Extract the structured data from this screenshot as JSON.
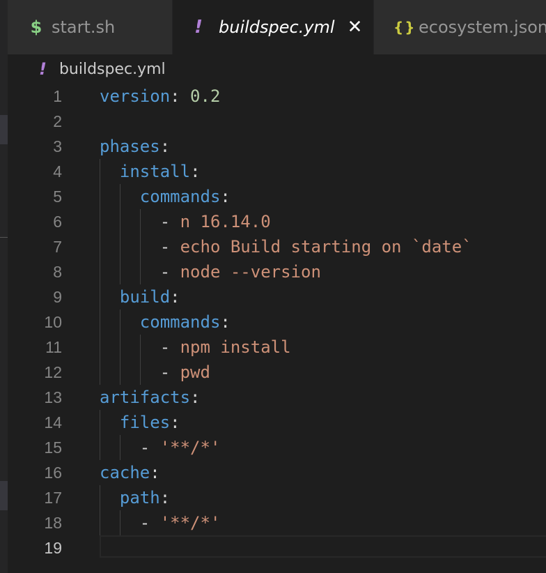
{
  "tabs": [
    {
      "icon": "$",
      "label": "start.sh"
    },
    {
      "icon": "!",
      "label": "buildspec.yml",
      "active": true
    },
    {
      "icon": "{}",
      "label": "ecosystem.json"
    }
  ],
  "close_glyph": "✕",
  "breadcrumb": {
    "icon": "!",
    "file": "buildspec.yml"
  },
  "colors": {
    "key": "#569cd6",
    "string": "#ce9178",
    "number": "#b5cea8",
    "shell_icon": "#89d185",
    "yaml_icon": "#b180d7",
    "json_icon": "#cbcb41"
  },
  "editor": {
    "current_line": 19,
    "lines": [
      {
        "num": "1",
        "indent": "",
        "key": "version",
        "colon": ":",
        "value": " 0.2",
        "value_type": "number"
      },
      {
        "num": "2",
        "indent": "",
        "key": "",
        "colon": "",
        "value": "",
        "value_type": ""
      },
      {
        "num": "3",
        "indent": "",
        "key": "phases",
        "colon": ":",
        "value": "",
        "value_type": ""
      },
      {
        "num": "4",
        "indent": "  ",
        "key": "install",
        "colon": ":",
        "value": "",
        "value_type": ""
      },
      {
        "num": "5",
        "indent": "    ",
        "key": "commands",
        "colon": ":",
        "value": "",
        "value_type": ""
      },
      {
        "num": "6",
        "indent": "      ",
        "key": "",
        "colon": "",
        "dash": "- ",
        "value": "n 16.14.0",
        "value_type": "string"
      },
      {
        "num": "7",
        "indent": "      ",
        "key": "",
        "colon": "",
        "dash": "- ",
        "value": "echo Build starting on `date`",
        "value_type": "string"
      },
      {
        "num": "8",
        "indent": "      ",
        "key": "",
        "colon": "",
        "dash": "- ",
        "value": "node --version",
        "value_type": "string"
      },
      {
        "num": "9",
        "indent": "  ",
        "key": "build",
        "colon": ":",
        "value": "",
        "value_type": ""
      },
      {
        "num": "10",
        "indent": "    ",
        "key": "commands",
        "colon": ":",
        "value": "",
        "value_type": ""
      },
      {
        "num": "11",
        "indent": "      ",
        "key": "",
        "colon": "",
        "dash": "- ",
        "value": "npm install",
        "value_type": "string"
      },
      {
        "num": "12",
        "indent": "      ",
        "key": "",
        "colon": "",
        "dash": "- ",
        "value": "pwd",
        "value_type": "string"
      },
      {
        "num": "13",
        "indent": "",
        "key": "artifacts",
        "colon": ":",
        "value": "",
        "value_type": ""
      },
      {
        "num": "14",
        "indent": "  ",
        "key": "files",
        "colon": ":",
        "value": "",
        "value_type": ""
      },
      {
        "num": "15",
        "indent": "    ",
        "key": "",
        "colon": "",
        "dash": "- ",
        "value": "'**/*'",
        "value_type": "string"
      },
      {
        "num": "16",
        "indent": "",
        "key": "cache",
        "colon": ":",
        "value": "",
        "value_type": ""
      },
      {
        "num": "17",
        "indent": "  ",
        "key": "path",
        "colon": ":",
        "value": "",
        "value_type": ""
      },
      {
        "num": "18",
        "indent": "    ",
        "key": "",
        "colon": "",
        "dash": "- ",
        "value": "'**/*'",
        "value_type": "string"
      },
      {
        "num": "19",
        "indent": "",
        "key": "",
        "colon": "",
        "value": "",
        "value_type": ""
      }
    ]
  }
}
